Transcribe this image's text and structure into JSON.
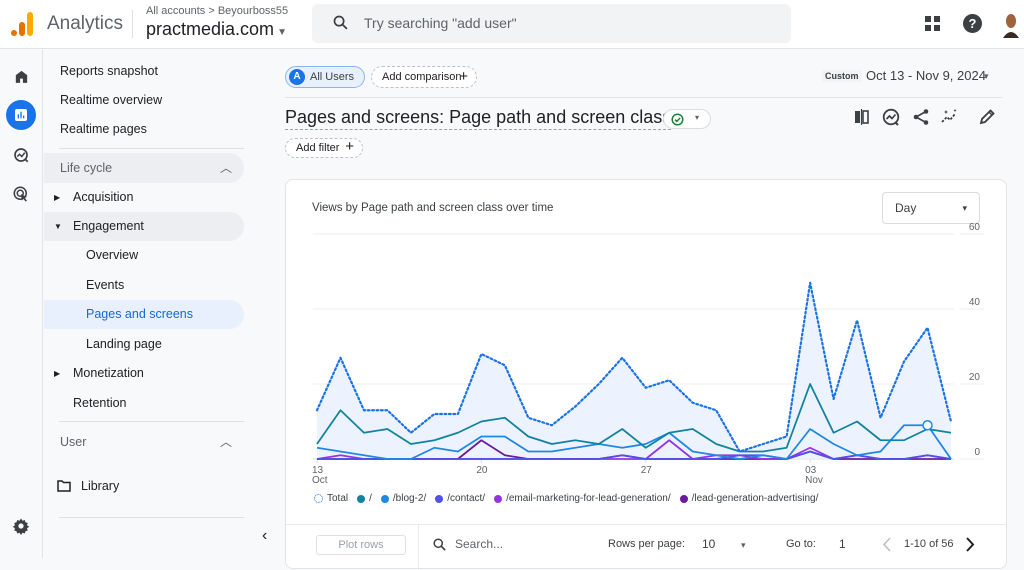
{
  "header": {
    "app_name": "Analytics",
    "breadcrumb": "All accounts > Beyourboss55",
    "property": "practmedia.com",
    "search_placeholder": "Try searching \"add user\"",
    "help_glyph": "?"
  },
  "rail": {
    "icons": [
      "home-icon",
      "reports-icon",
      "explore-icon",
      "advertising-icon",
      "settings-icon"
    ]
  },
  "nav": {
    "top_items": [
      "Reports snapshot",
      "Realtime overview",
      "Realtime pages"
    ],
    "lifecycle_header": "Life cycle",
    "lifecycle": [
      {
        "label": "Acquisition",
        "expandable": true,
        "expanded": false
      },
      {
        "label": "Engagement",
        "expandable": true,
        "expanded": true
      },
      {
        "label": "Overview",
        "child": true
      },
      {
        "label": "Events",
        "child": true
      },
      {
        "label": "Pages and screens",
        "child": true,
        "selected": true
      },
      {
        "label": "Landing page",
        "child": true
      },
      {
        "label": "Monetization",
        "expandable": true,
        "expanded": false
      },
      {
        "label": "Retention"
      }
    ],
    "user_header": "User",
    "library": "Library",
    "collapse_glyph": "‹"
  },
  "toolbar": {
    "segment_letter": "A",
    "segment": "All Users",
    "add_comparison": "Add comparison",
    "date_label": "Custom",
    "date_range": "Oct 13 - Nov 9, 2024",
    "page_title": "Pages and screens: Page path and screen class",
    "add_filter": "Add filter",
    "plus": "+",
    "caret": "▾"
  },
  "card": {
    "title": "Views by Page path and screen class over time",
    "granularity": "Day"
  },
  "chart_data": {
    "type": "line",
    "title": "Views by Page path and screen class over time",
    "x_start": "2024-10-13",
    "x_end": "2024-11-09",
    "x_tick_labels": [
      {
        "day_index": 0,
        "label": "13",
        "sub": "Oct"
      },
      {
        "day_index": 7,
        "label": "20",
        "sub": ""
      },
      {
        "day_index": 14,
        "label": "27",
        "sub": ""
      },
      {
        "day_index": 21,
        "label": "03",
        "sub": "Nov"
      }
    ],
    "y_ticks": [
      0,
      20,
      40,
      60
    ],
    "ylim": [
      0,
      60
    ],
    "y_axis_side": "right",
    "grid": true,
    "legend_position": "bottom-left",
    "series": [
      {
        "name": "Total",
        "color": "#1a73e8",
        "style": "dotted-area",
        "values": [
          13,
          27,
          13,
          13,
          7,
          12,
          12,
          28,
          25,
          11,
          9,
          14,
          20,
          27,
          19,
          21,
          15,
          13,
          2,
          4,
          6,
          47,
          16,
          37,
          11,
          26,
          35,
          10
        ]
      },
      {
        "name": "/",
        "color": "#12839e",
        "values": [
          4,
          13,
          7,
          8,
          4,
          5,
          7,
          10,
          11,
          6,
          4,
          5,
          4,
          8,
          3,
          7,
          8,
          4,
          2,
          2,
          3,
          20,
          7,
          10,
          5,
          5,
          8,
          7
        ]
      },
      {
        "name": "/blog-2/",
        "color": "#1e88e5",
        "values": [
          3,
          2,
          1,
          0,
          0,
          3,
          2,
          6,
          6,
          2,
          2,
          3,
          4,
          3,
          4,
          7,
          2,
          1,
          0,
          1,
          0,
          8,
          4,
          1,
          2,
          9,
          9,
          0
        ]
      },
      {
        "name": "/contact/",
        "color": "#4f52e8",
        "values": [
          0,
          0,
          0,
          0,
          0,
          0,
          0,
          0,
          0,
          0,
          0,
          0,
          0,
          1,
          0,
          0,
          0,
          0,
          1,
          1,
          0,
          2,
          0,
          1,
          0,
          0,
          1,
          0
        ]
      },
      {
        "name": "/email-marketing-for-lead-generation/",
        "color": "#9334e6",
        "values": [
          0,
          1,
          0,
          0,
          0,
          0,
          0,
          0,
          0,
          0,
          0,
          0,
          0,
          0,
          0,
          5,
          0,
          1,
          1,
          0,
          0,
          3,
          0,
          1,
          0,
          0,
          1,
          0
        ]
      },
      {
        "name": "/lead-generation-advertising/",
        "color": "#6a1b9a",
        "values": [
          0,
          0,
          0,
          0,
          0,
          0,
          0,
          5,
          1,
          0,
          0,
          0,
          0,
          1,
          0,
          0,
          0,
          0,
          0,
          0,
          0,
          2,
          0,
          0,
          0,
          0,
          0,
          0
        ]
      }
    ],
    "highlight_point": {
      "series": "/blog-2/",
      "day_index": 26
    }
  },
  "table_controls": {
    "plot_rows": "Plot rows",
    "search_placeholder": "Search...",
    "rows_per_page_label": "Rows per page:",
    "rows_per_page": "10",
    "goto_label": "Go to:",
    "goto_value": "1",
    "range": "1-10 of 56"
  }
}
